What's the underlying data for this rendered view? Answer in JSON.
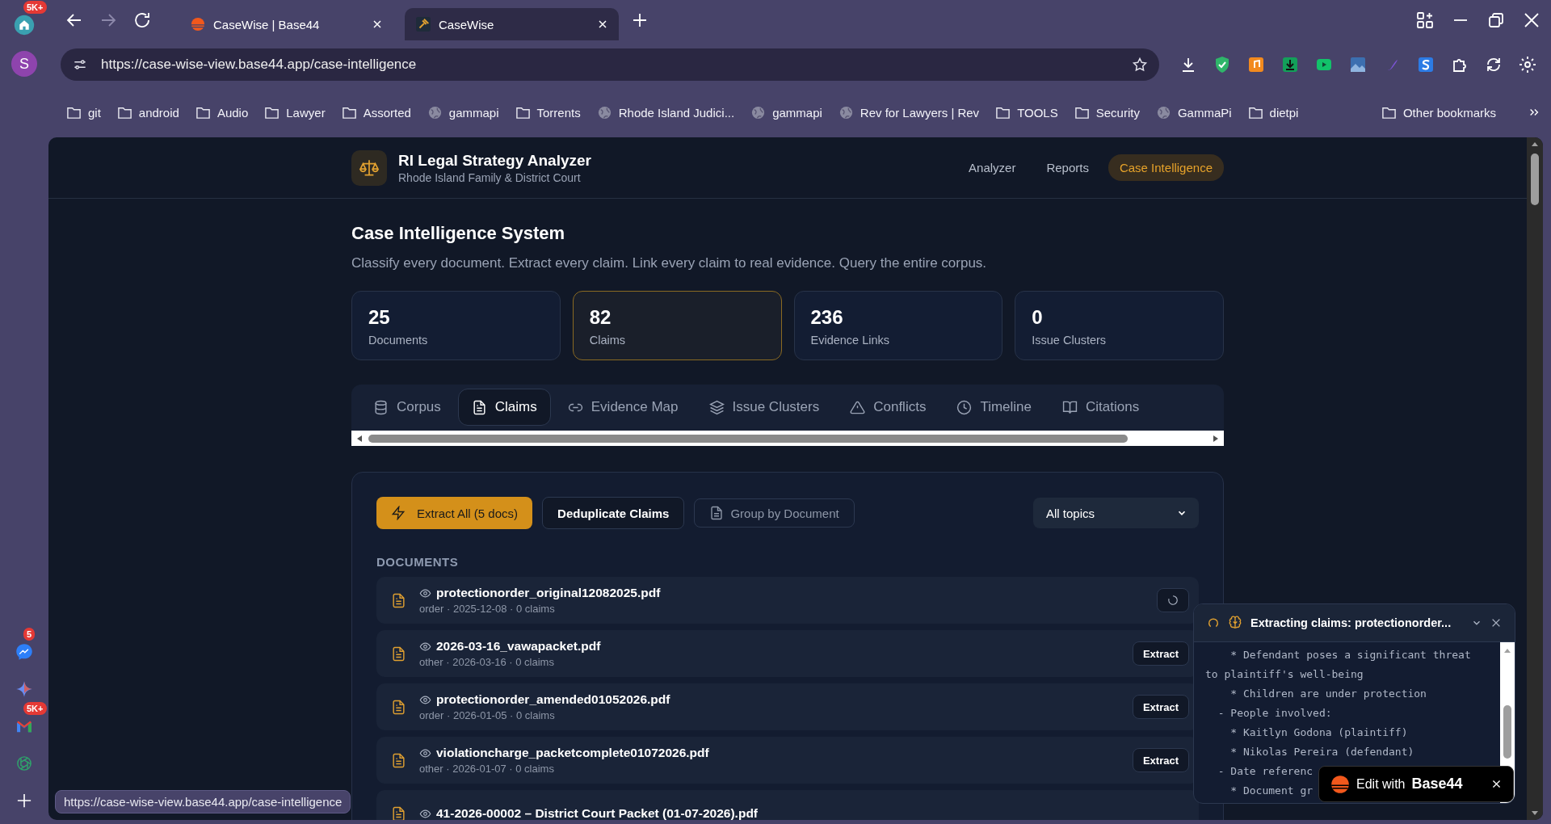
{
  "browser": {
    "sidebar_top": [
      {
        "kind": "home",
        "badge": "5K+"
      },
      {
        "kind": "avatar",
        "label": "S"
      }
    ],
    "sidebar_bottom": [
      {
        "kind": "messenger",
        "badge": "5"
      },
      {
        "kind": "sparkle"
      },
      {
        "kind": "mail",
        "badge": "5K+"
      },
      {
        "kind": "chatbot"
      },
      {
        "kind": "add"
      }
    ],
    "tabs": [
      {
        "title": "CaseWise | Base44",
        "selected": false
      },
      {
        "title": "CaseWise",
        "selected": true
      }
    ],
    "url": "https://case-wise-view.base44.app/case-intelligence",
    "bookmarks": [
      {
        "label": "git",
        "kind": "folder"
      },
      {
        "label": "android",
        "kind": "folder"
      },
      {
        "label": "Audio",
        "kind": "folder"
      },
      {
        "label": "Lawyer",
        "kind": "folder"
      },
      {
        "label": "Assorted",
        "kind": "folder"
      },
      {
        "label": "gammapi",
        "kind": "globe"
      },
      {
        "label": "Torrents",
        "kind": "folder"
      },
      {
        "label": "Rhode Island Judici...",
        "kind": "globe"
      },
      {
        "label": "gammapi",
        "kind": "globe"
      },
      {
        "label": "Rev for Lawyers | Rev",
        "kind": "globe"
      },
      {
        "label": "TOOLS",
        "kind": "folder"
      },
      {
        "label": "Security",
        "kind": "folder"
      },
      {
        "label": "GammaPi",
        "kind": "globe"
      },
      {
        "label": "dietpi",
        "kind": "folder"
      }
    ],
    "other_bookmarks": "Other bookmarks",
    "status_url": "https://case-wise-view.base44.app/case-intelligence"
  },
  "app": {
    "title": "RI Legal Strategy Analyzer",
    "subtitle": "Rhode Island Family & District Court",
    "nav": [
      {
        "label": "Analyzer",
        "selected": false
      },
      {
        "label": "Reports",
        "selected": false
      },
      {
        "label": "Case Intelligence",
        "selected": true
      }
    ]
  },
  "page": {
    "title": "Case Intelligence System",
    "description": "Classify every document. Extract every claim. Link every claim to real evidence. Query the entire corpus."
  },
  "stats": [
    {
      "value": "25",
      "label": "Documents",
      "selected": false
    },
    {
      "value": "82",
      "label": "Claims",
      "selected": true
    },
    {
      "value": "236",
      "label": "Evidence Links",
      "selected": false
    },
    {
      "value": "0",
      "label": "Issue Clusters",
      "selected": false
    }
  ],
  "tabs": [
    {
      "label": "Corpus",
      "selected": false
    },
    {
      "label": "Claims",
      "selected": true
    },
    {
      "label": "Evidence Map",
      "selected": false
    },
    {
      "label": "Issue Clusters",
      "selected": false
    },
    {
      "label": "Conflicts",
      "selected": false
    },
    {
      "label": "Timeline",
      "selected": false
    },
    {
      "label": "Citations",
      "selected": false
    }
  ],
  "toolbar": {
    "extract_all": "Extract All (5 docs)",
    "deduplicate": "Deduplicate Claims",
    "group_by": "Group by Document",
    "topic_filter": "All topics"
  },
  "documents_heading": "DOCUMENTS",
  "documents": [
    {
      "name": "protectionorder_original12082025.pdf",
      "meta": "order · 2025-12-08 · 0 claims",
      "loading": true
    },
    {
      "name": "2026-03-16_vawapacket.pdf",
      "meta": "other · 2026-03-16 · 0 claims",
      "loading": false,
      "action_label": "Extract"
    },
    {
      "name": "protectionorder_amended01052026.pdf",
      "meta": "order · 2026-01-05 · 0 claims",
      "loading": false,
      "action_label": "Extract"
    },
    {
      "name": "violationcharge_packetcomplete01072026.pdf",
      "meta": "other · 2026-01-07 · 0 claims",
      "loading": false,
      "action_label": "Extract"
    },
    {
      "name": "41-2026-00002 – District Court Packet (01-07-2026).pdf",
      "loading": false
    }
  ],
  "extraction_panel": {
    "title": "Extracting claims: protectionorder...",
    "log": [
      "    * Defendant poses a significant threat to plaintiff's well-being",
      "    * Children are under protection",
      "  - People involved:",
      "    * Kaitlyn Godona (plaintiff)",
      "    * Nikolas Pereira (defendant)",
      "  - Date referenc",
      "    * Document gr"
    ]
  },
  "edit_badge": {
    "label": "Edit with",
    "brand": "Base44"
  }
}
